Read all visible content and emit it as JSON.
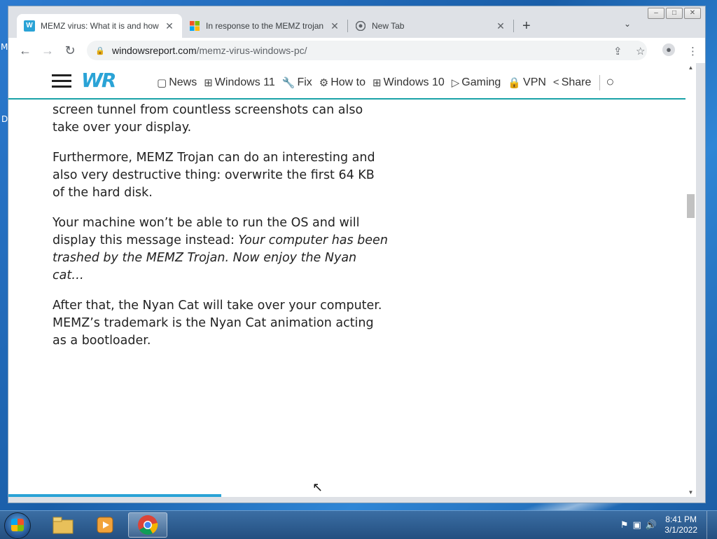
{
  "desktop": {
    "left_letters": [
      "M",
      "D"
    ]
  },
  "window": {
    "controls": [
      "–",
      "□",
      "✕"
    ]
  },
  "tabs": [
    {
      "title": "MEMZ virus: What it is and how t",
      "favicon": "W",
      "active": true
    },
    {
      "title": "In response to the MEMZ trojan",
      "favicon": "ms-icon",
      "active": false
    },
    {
      "title": "New Tab",
      "favicon": "chrome-icon",
      "active": false
    }
  ],
  "toolbar": {
    "url_host": "windowsreport.com",
    "url_path": "/memz-virus-windows-pc/"
  },
  "site": {
    "logo": "WR",
    "nav": [
      {
        "label": "News",
        "icon": "▢"
      },
      {
        "label": "Windows 11",
        "icon": "⊞"
      },
      {
        "label": "Fix",
        "icon": "🔧"
      },
      {
        "label": "How to",
        "icon": "⚙"
      },
      {
        "label": "Windows 10",
        "icon": "⊞"
      },
      {
        "label": "Gaming",
        "icon": "▷"
      },
      {
        "label": "VPN",
        "icon": "🔒"
      },
      {
        "label": "Share",
        "icon": "<"
      }
    ]
  },
  "article": {
    "p1": "screen tunnel from countless screenshots can also take over your display.",
    "p2": "Furthermore, MEMZ Trojan can do an interesting and also very destructive thing: overwrite the first 64 KB of the hard disk.",
    "p3_text": "Your machine won’t be able to run the OS and will display this message instead: ",
    "p3_italic": "Your computer has been trashed by the MEMZ Trojan. Now enjoy the Nyan cat…",
    "p4": "After that, the Nyan Cat will take over your computer. MEMZ’s trademark is the Nyan Cat animation acting as a bootloader."
  },
  "taskbar": {
    "time": "8:41 PM",
    "date": "3/1/2022"
  },
  "colors": {
    "accent": "#1aa3a8",
    "logo": "#2aa3d6"
  }
}
